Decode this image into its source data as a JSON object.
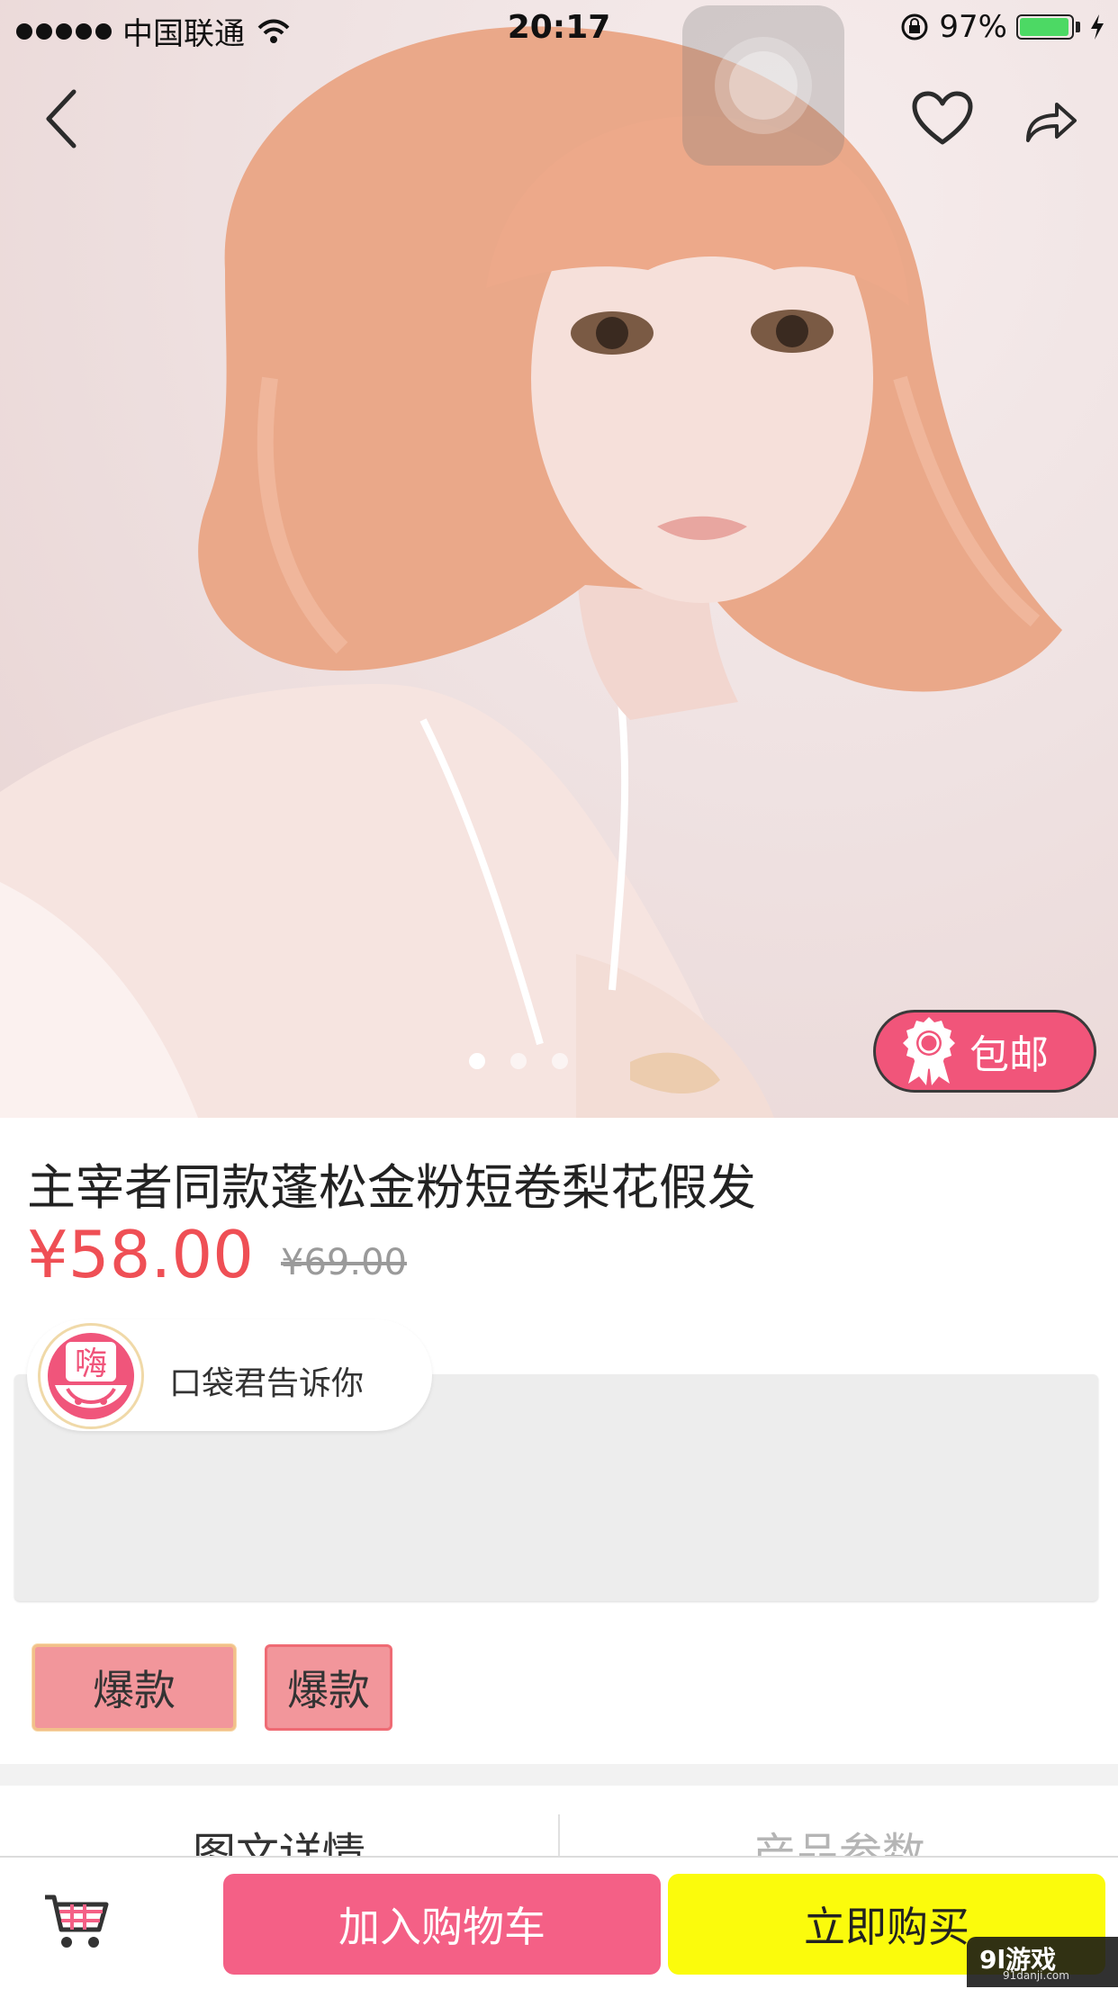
{
  "status_bar": {
    "carrier": "中国联通",
    "time": "20:17",
    "battery_percent": "97%",
    "battery_level": 0.97
  },
  "product": {
    "title": "主宰者同款蓬松金粉短卷梨花假发",
    "price": "¥58.00",
    "original_price": "¥69.00",
    "shipping_badge": "包邮",
    "gallery_page_count": 3,
    "gallery_active_index": 0
  },
  "tip": {
    "text": "口袋君告诉你",
    "avatar_glyph": "嗨"
  },
  "tags": [
    "爆款",
    "爆款"
  ],
  "tabs": [
    "图文详情",
    "产品参数"
  ],
  "bottom_bar": {
    "add_to_cart": "加入购物车",
    "buy_now": "立即购买"
  },
  "watermark": {
    "main": "9l游戏",
    "sub": "91danji.com"
  },
  "icons": {
    "back": "chevron-left-icon",
    "favorite": "heart-outline-icon",
    "share": "share-arrow-icon",
    "cart": "shopping-cart-icon",
    "badge": "ribbon-award-icon"
  },
  "colors": {
    "accent_pink": "#f46086",
    "price_red": "#ef4f55",
    "buy_yellow": "#fbfb0c",
    "tag_pink": "#f2969b"
  }
}
